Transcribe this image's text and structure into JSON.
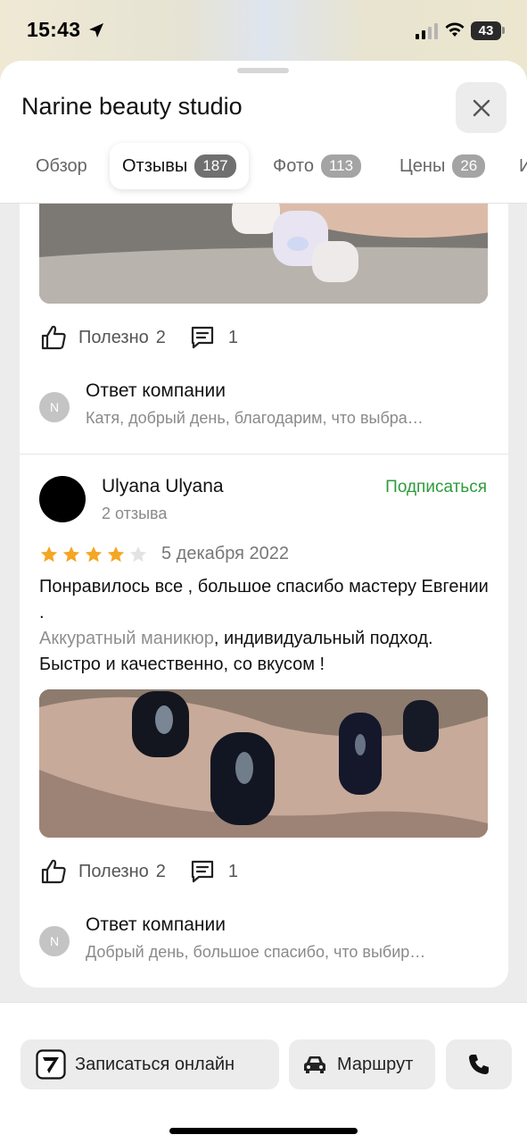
{
  "status_bar": {
    "time": "15:43",
    "battery": "43"
  },
  "header": {
    "title": "Narine beauty studio",
    "tabs": [
      {
        "label": "Обзор",
        "count": ""
      },
      {
        "label": "Отзывы",
        "count": "187"
      },
      {
        "label": "Фото",
        "count": "113"
      },
      {
        "label": "Цены",
        "count": "26"
      },
      {
        "label": "И",
        "count": ""
      }
    ]
  },
  "review1": {
    "helpful_label": "Полезно",
    "helpful_count": "2",
    "comments_count": "1",
    "reply": {
      "avatar_letter": "N",
      "title": "Ответ компании",
      "text": "Катя, добрый день, благодарим, что выбра…"
    }
  },
  "review2": {
    "author": "Ulyana Ulyana",
    "author_reviews": "2 отзыва",
    "subscribe_label": "Подписаться",
    "rating": 4,
    "date": "5 декабря 2022",
    "text_line1": "Понравилось все , большое спасибо мастеру Евгении .",
    "text_tag": "Аккуратный маникюр",
    "text_rest": ", индивидуальный подход. Быстро и качественно, со вкусом !",
    "helpful_label": "Полезно",
    "helpful_count": "2",
    "comments_count": "1",
    "reply": {
      "avatar_letter": "N",
      "title": "Ответ компании",
      "text": "Добрый день, большое спасибо, что выбир…"
    }
  },
  "bottom_bar": {
    "book_label": "Записаться онлайн",
    "route_label": "Маршрут"
  },
  "colors": {
    "accent_green": "#2e9b3c",
    "star_gold": "#f5a623",
    "star_empty": "#e3e3e3",
    "tab_badge": "#707070"
  }
}
